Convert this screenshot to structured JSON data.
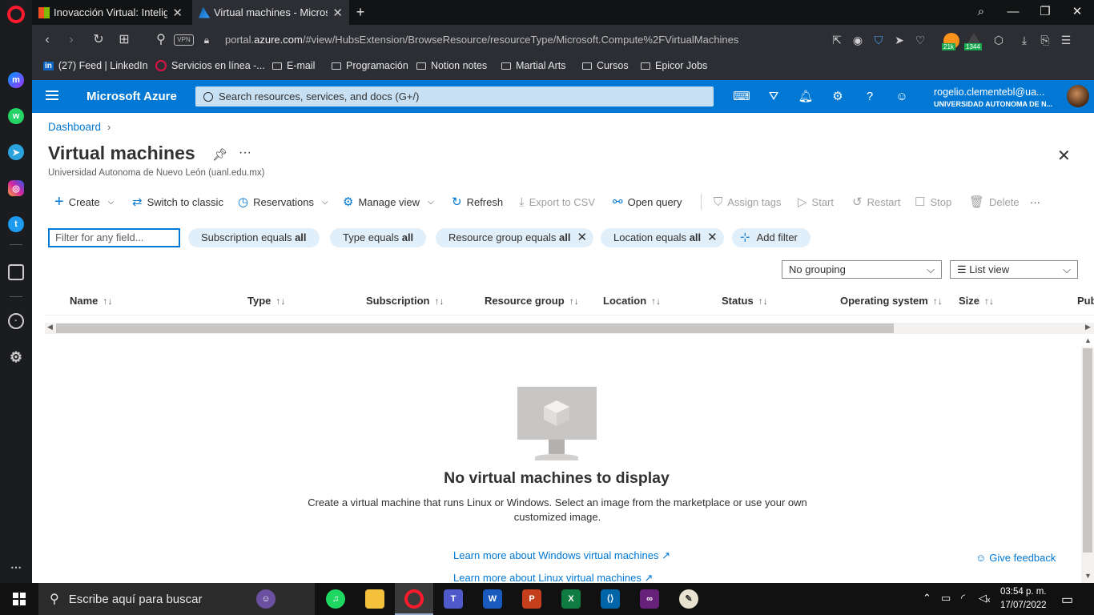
{
  "browser": {
    "tabs": [
      {
        "title": "Inovacción Virtual: Inteligen"
      },
      {
        "title": "Virtual machines - Microsoft"
      }
    ],
    "vpn_label": "VPN",
    "url_prefix": "portal.",
    "url_host": "azure.com",
    "url_path": "/#view/HubsExtension/BrowseResource/resourceType/Microsoft.Compute%2FVirtualMachines",
    "ext_badge1": "21k",
    "ext_badge2": "1344",
    "bookmarks": [
      {
        "label": "(27) Feed | LinkedIn"
      },
      {
        "label": "Servicios en línea -..."
      },
      {
        "label": "E-mail"
      },
      {
        "label": "Programación"
      },
      {
        "label": "Notion notes"
      },
      {
        "label": "Martial Arts"
      },
      {
        "label": "Cursos"
      },
      {
        "label": "Epicor Jobs"
      }
    ]
  },
  "azure": {
    "brand": "Microsoft Azure",
    "search_placeholder": "Search resources, services, and docs (G+/)",
    "user_email": "rogelio.clementebl@ua...",
    "user_org": "UNIVERSIDAD AUTONOMA DE N..."
  },
  "page": {
    "breadcrumb": "Dashboard",
    "title": "Virtual machines",
    "subtitle": "Universidad Autonoma de Nuevo León (uanl.edu.mx)",
    "commands": {
      "create": "Create",
      "switch_classic": "Switch to classic",
      "reservations": "Reservations",
      "manage_view": "Manage view",
      "refresh": "Refresh",
      "export_csv": "Export to CSV",
      "open_query": "Open query",
      "assign_tags": "Assign tags",
      "start": "Start",
      "restart": "Restart",
      "stop": "Stop",
      "delete": "Delete"
    },
    "filter_placeholder": "Filter for any field...",
    "filters": [
      {
        "label": "Subscription equals ",
        "value": "all"
      },
      {
        "label": "Type equals ",
        "value": "all"
      },
      {
        "label": "Resource group equals ",
        "value": "all"
      },
      {
        "label": "Location equals ",
        "value": "all"
      }
    ],
    "add_filter": "Add filter",
    "grouping": "No grouping",
    "view": "List view",
    "columns": [
      "Name",
      "Type",
      "Subscription",
      "Resource group",
      "Location",
      "Status",
      "Operating system",
      "Size",
      "Pub"
    ],
    "empty_title": "No virtual machines to display",
    "empty_desc": "Create a virtual machine that runs Linux or Windows. Select an image from the marketplace or use your own customized image.",
    "link_windows": "Learn more about Windows virtual machines",
    "link_linux": "Learn more about Linux virtual machines",
    "feedback": "Give feedback"
  },
  "taskbar": {
    "search_placeholder": "Escribe aquí para buscar",
    "time": "03:54 p. m.",
    "date": "17/07/2022"
  }
}
